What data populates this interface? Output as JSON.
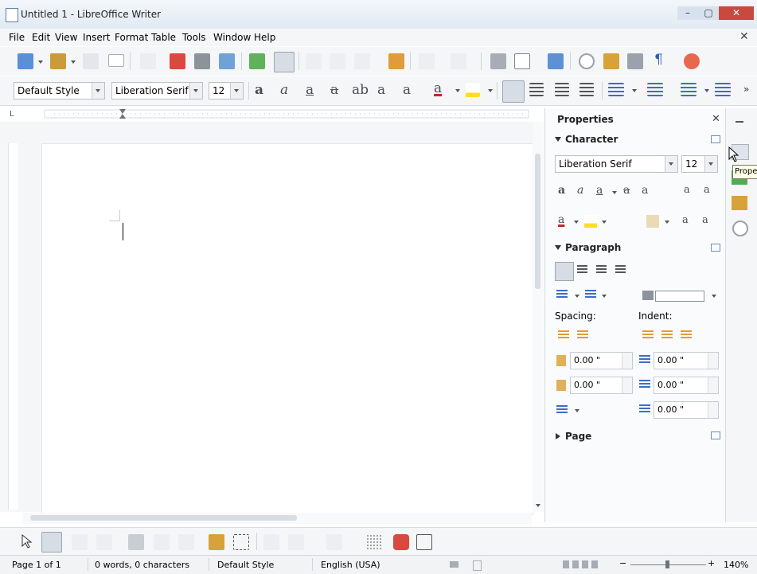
{
  "window": {
    "title": "Untitled 1 - LibreOffice Writer",
    "min": "–",
    "max": "▢",
    "close": "✕"
  },
  "menu": {
    "items": [
      "File",
      "Edit",
      "View",
      "Insert",
      "Format",
      "Table",
      "Tools",
      "Window",
      "Help"
    ],
    "close_doc": "✕"
  },
  "formatting": {
    "paragraph_style": "Default Style",
    "font_name": "Liberation Serif",
    "font_size": "12"
  },
  "sidebar": {
    "title": "Properties",
    "close": "✕",
    "character": {
      "heading": "Character",
      "font_name": "Liberation Serif",
      "font_size": "12"
    },
    "paragraph": {
      "heading": "Paragraph",
      "spacing_label": "Spacing:",
      "indent_label": "Indent:",
      "above": "0.00 \"",
      "below": "0.00 \"",
      "before_text": "0.00 \"",
      "after_text": "0.00 \"",
      "first_line": "0.00 \""
    },
    "page": {
      "heading": "Page"
    }
  },
  "tooltip": "Prope",
  "status": {
    "page": "Page 1 of 1",
    "words": "0 words, 0 characters",
    "style": "Default Style",
    "language": "English (USA)",
    "zoom": "140%"
  },
  "colors": {
    "accent": "#3d6ec4",
    "font_color": "#c1272d",
    "highlight": "#ffde21",
    "close_red": "#c84a3e"
  },
  "icons": [
    "new-icon",
    "open-icon",
    "save-icon",
    "email-icon",
    "edit-doc-icon",
    "pdf-icon",
    "print-icon",
    "print-preview-icon",
    "spellcheck-icon",
    "autospellcheck-icon",
    "cut-icon",
    "copy-icon",
    "paste-icon",
    "clone-format-icon",
    "undo-icon",
    "redo-icon",
    "find-icon",
    "table-icon",
    "image-icon",
    "chart-icon",
    "navigator-icon",
    "gallery-icon",
    "datasource-icon",
    "formatting-marks-icon",
    "help-icon"
  ]
}
